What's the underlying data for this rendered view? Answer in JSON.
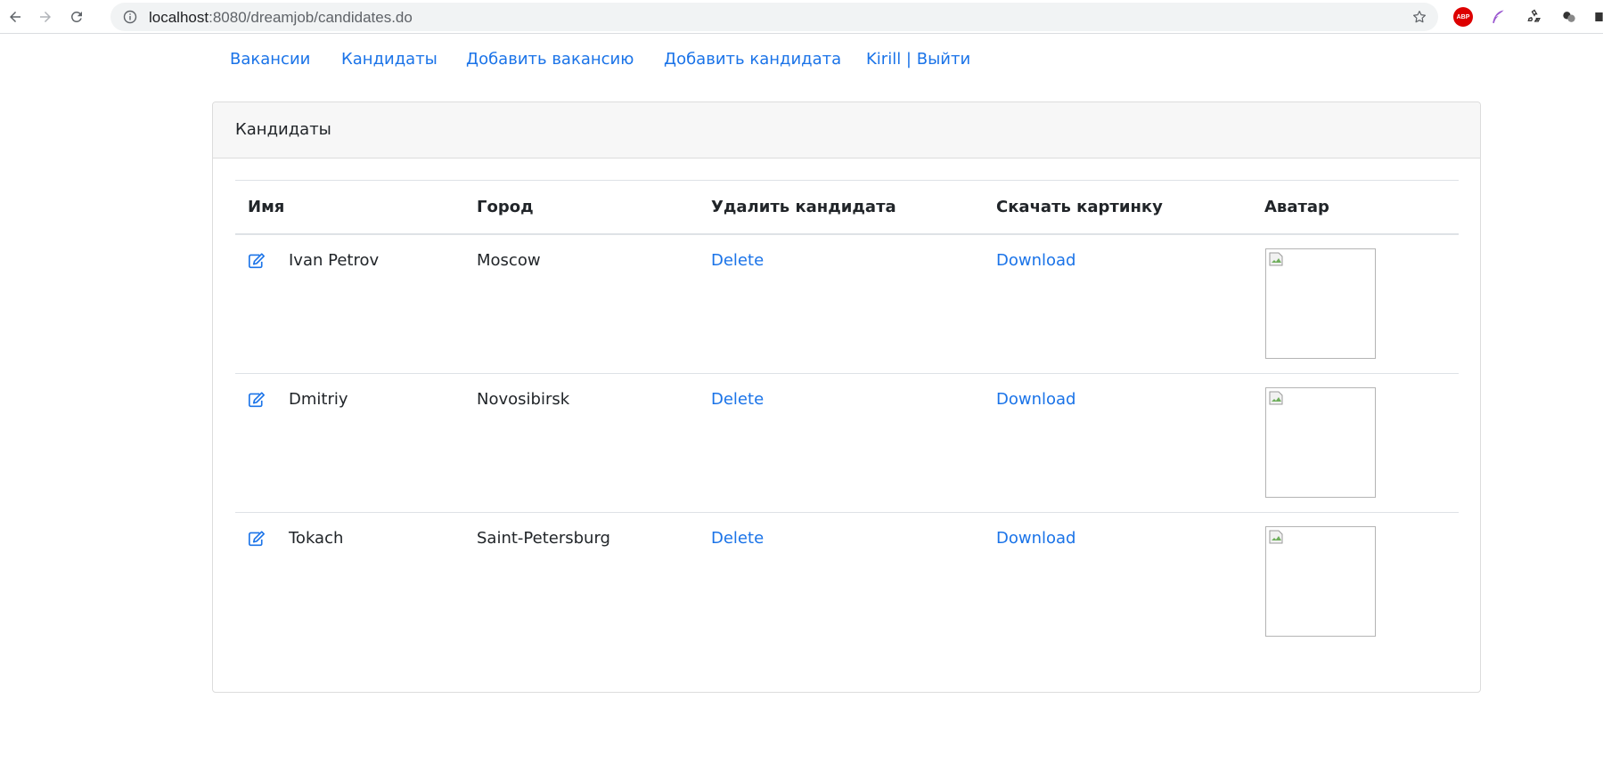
{
  "browser": {
    "url_host": "localhost",
    "url_rest": ":8080/dreamjob/candidates.do",
    "extensions": [
      "abp-icon",
      "feather-icon",
      "recycle-icon",
      "dots-icon",
      "puzzle-icon"
    ],
    "abp_label": "ABP"
  },
  "nav": {
    "vacancies": "Вакансии",
    "candidates": "Кандидаты",
    "add_vacancy": "Добавить вакансию",
    "add_candidate": "Добавить кандидата",
    "user_logout": "Kirill | Выйти"
  },
  "card": {
    "title": "Кандидаты",
    "headers": {
      "name": "Имя",
      "city": "Город",
      "delete": "Удалить кандидата",
      "download": "Скачать картинку",
      "avatar": "Аватар"
    },
    "rows": [
      {
        "name": "Ivan Petrov",
        "city": "Moscow",
        "delete": "Delete",
        "download": "Download"
      },
      {
        "name": "Dmitriy",
        "city": "Novosibirsk",
        "delete": "Delete",
        "download": "Download"
      },
      {
        "name": "Tokach",
        "city": "Saint-Petersburg",
        "delete": "Delete",
        "download": "Download"
      }
    ]
  },
  "colors": {
    "link": "#1a73e8",
    "text": "#212529",
    "header_bg": "#f7f7f7",
    "border": "#dee2e6"
  }
}
